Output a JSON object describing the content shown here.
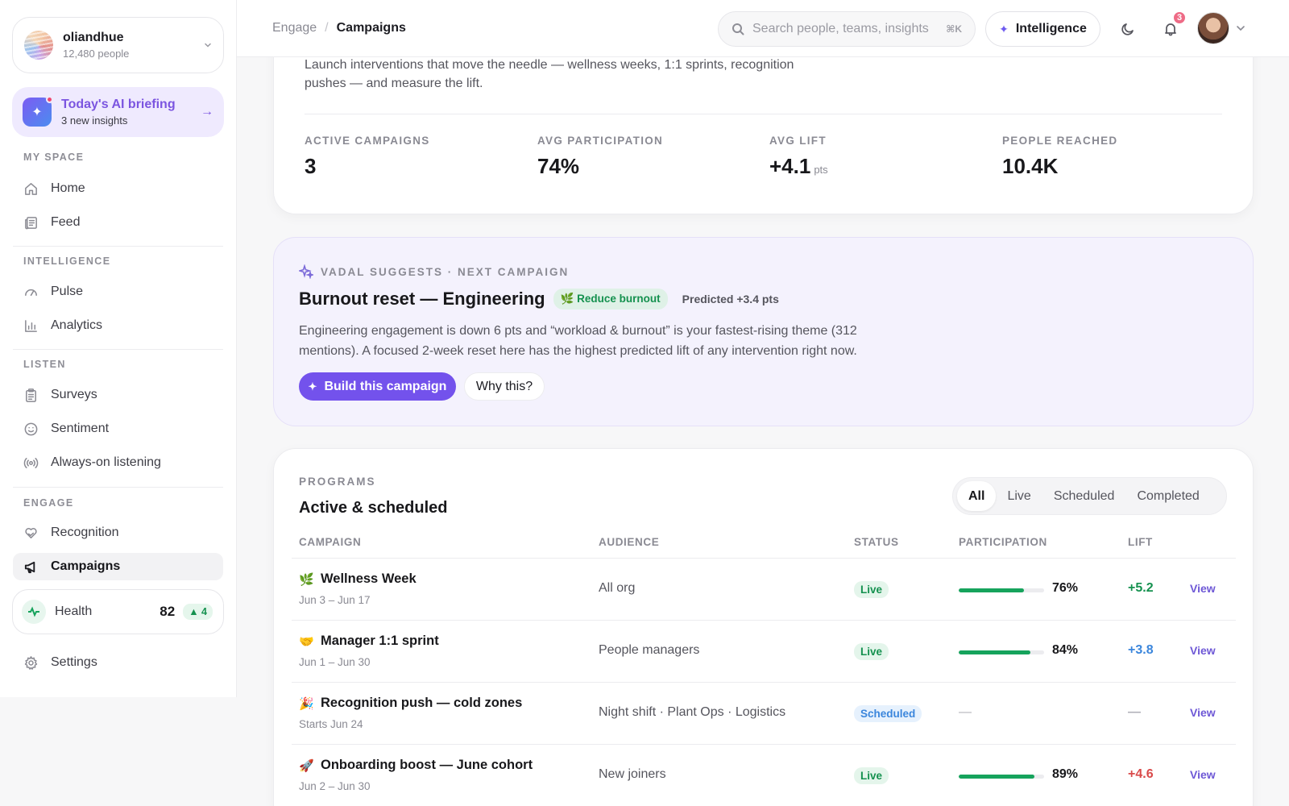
{
  "sidebar": {
    "workspace": {
      "name": "oliandhue",
      "people": "12,480 people"
    },
    "briefing": {
      "title": "Today's AI briefing",
      "subtitle": "3 new insights"
    },
    "sections": {
      "my_space": "MY SPACE",
      "intelligence": "INTELLIGENCE",
      "listen": "LISTEN",
      "engage": "ENGAGE"
    },
    "items": [
      {
        "label": "Home",
        "icon": "home-icon"
      },
      {
        "label": "Feed",
        "icon": "feed-icon"
      },
      {
        "label": "Pulse",
        "icon": "gauge-icon"
      },
      {
        "label": "Analytics",
        "icon": "bar-chart-icon"
      },
      {
        "label": "Surveys",
        "icon": "clipboard-icon"
      },
      {
        "label": "Sentiment",
        "icon": "smile-icon"
      },
      {
        "label": "Always-on listening",
        "icon": "broadcast-icon"
      },
      {
        "label": "Recognition",
        "icon": "heart-hand-icon"
      },
      {
        "label": "Campaigns",
        "icon": "megaphone-icon",
        "active": true
      },
      {
        "label": "Settings",
        "icon": "gear-icon"
      }
    ],
    "health": {
      "label": "Health",
      "score": "82",
      "delta": "4"
    }
  },
  "topbar": {
    "breadcrumb": {
      "parent": "Engage",
      "separator": "/",
      "current": "Campaigns"
    },
    "search": {
      "placeholder": "Search people, teams, insights",
      "shortcut": "⌘K"
    },
    "intelligence_label": "Intelligence",
    "notification_count": "3"
  },
  "hero": {
    "description": "Launch interventions that move the needle — wellness weeks, 1:1 sprints, recognition pushes — and measure the lift.",
    "stats": [
      {
        "label": "ACTIVE CAMPAIGNS",
        "value": "3",
        "unit": ""
      },
      {
        "label": "AVG PARTICIPATION",
        "value": "74%",
        "unit": ""
      },
      {
        "label": "AVG LIFT",
        "value": "+4.1",
        "unit": "pts"
      },
      {
        "label": "PEOPLE REACHED",
        "value": "10.4K",
        "unit": ""
      }
    ]
  },
  "suggestion": {
    "kicker": "VADAL SUGGESTS · NEXT CAMPAIGN",
    "title": "Burnout reset — Engineering",
    "tag": "🌿 Reduce burnout",
    "predicted": "Predicted +3.4 pts",
    "body": "Engineering engagement is down 6 pts and “workload & burnout” is your fastest-rising theme (312 mentions). A focused 2-week reset here has the highest predicted lift of any intervention right now.",
    "primary_cta": "Build this campaign",
    "secondary_cta": "Why this?"
  },
  "programs": {
    "kicker": "PROGRAMS",
    "title": "Active & scheduled",
    "filters": [
      "All",
      "Live",
      "Scheduled",
      "Completed"
    ],
    "active_filter": "All",
    "columns": [
      "CAMPAIGN",
      "AUDIENCE",
      "STATUS",
      "PARTICIPATION",
      "LIFT"
    ],
    "rows": [
      {
        "emoji": "🌿",
        "name": "Wellness Week",
        "dates": "Jun 3 – Jun 17",
        "audience": "All org",
        "status": "Live",
        "participation": "76%",
        "participation_value": 0.76,
        "lift": "+5.2",
        "lift_color": "#15914f",
        "view": "View"
      },
      {
        "emoji": "🤝",
        "name": "Manager 1:1 sprint",
        "dates": "Jun 1 – Jun 30",
        "audience": "People managers",
        "status": "Live",
        "participation": "84%",
        "participation_value": 0.84,
        "lift": "+3.8",
        "lift_color": "#3b86dc",
        "view": "View"
      },
      {
        "emoji": "🎉",
        "name": "Recognition push — cold zones",
        "dates": "Starts Jun 24",
        "audience": "Night shift · Plant Ops · Logistics",
        "status": "Scheduled",
        "participation": "—",
        "participation_value": null,
        "lift": "—",
        "lift_color": "#b0b0b8",
        "view": "View"
      },
      {
        "emoji": "🚀",
        "name": "Onboarding boost — June cohort",
        "dates": "Jun 2 – Jun 30",
        "audience": "New joiners",
        "status": "Live",
        "participation": "89%",
        "participation_value": 0.89,
        "lift": "+4.6",
        "lift_color": "#d94a4a",
        "view": "View"
      }
    ]
  }
}
